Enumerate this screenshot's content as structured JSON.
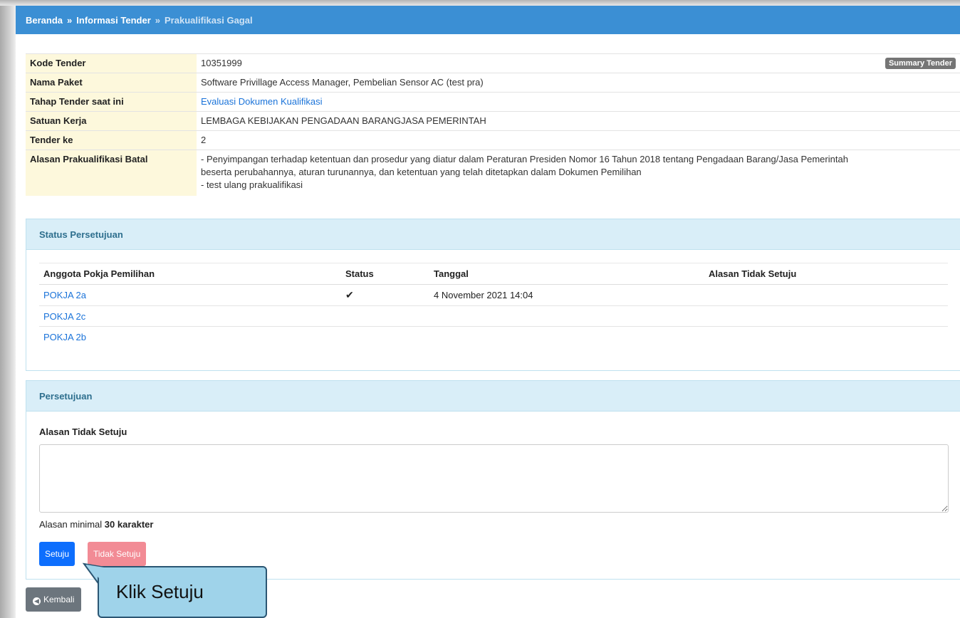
{
  "breadcrumb": {
    "home": "Beranda",
    "separator": "»",
    "info": "Informasi Tender",
    "current": "Prakualifikasi Gagal"
  },
  "info_table": {
    "summary_button": "Summary Tender",
    "rows": [
      {
        "key": "Kode Tender",
        "value": "10351999"
      },
      {
        "key": "Nama Paket",
        "value": "Software Privillage Access Manager, Pembelian Sensor AC (test pra)"
      },
      {
        "key": "Tahap Tender saat ini",
        "value": "Evaluasi Dokumen Kualifikasi"
      },
      {
        "key": "Satuan Kerja",
        "value": "LEMBAGA KEBIJAKAN PENGADAAN BARANGJASA PEMERINTAH"
      },
      {
        "key": "Tender ke",
        "value": "2"
      },
      {
        "key": "Alasan Prakualifikasi Batal",
        "line1": "- Penyimpangan terhadap ketentuan dan prosedur yang diatur dalam Peraturan Presiden Nomor 16 Tahun 2018 tentang Pengadaan Barang/Jasa Pemerintah",
        "line2": "beserta perubahannya, aturan turunannya, dan ketentuan yang telah ditetapkan dalam Dokumen Pemilihan",
        "line3": "- test ulang prakualifikasi"
      }
    ]
  },
  "status_panel": {
    "title": "Status Persetujuan",
    "columns": [
      "Anggota Pokja Pemilihan",
      "Status",
      "Tanggal",
      "Alasan Tidak Setuju"
    ],
    "rows": [
      {
        "member": "POKJA 2a",
        "status_icon": "check-icon",
        "status_glyph": "✔",
        "date": "4 November 2021 14:04",
        "reason": ""
      },
      {
        "member": "POKJA 2c",
        "status_glyph": "",
        "date": "",
        "reason": ""
      },
      {
        "member": "POKJA 2b",
        "status_glyph": "",
        "date": "",
        "reason": ""
      }
    ]
  },
  "approval_panel": {
    "title": "Persetujuan",
    "reason_label": "Alasan Tidak Setuju",
    "reason_value": "",
    "hint_prefix": "Alasan minimal",
    "hint_bold": "30 karakter",
    "approve_label": "Setuju",
    "reject_label": "Tidak Setuju"
  },
  "back_button": {
    "icon": "arrow-left-circle-icon",
    "label": "Kembali"
  },
  "callout": {
    "text": "Klik Setuju"
  },
  "colors": {
    "header": "#3b8fd4",
    "panel_head": "#d9eef8",
    "primary": "#0d6efd",
    "danger": "#f28b95",
    "callout": "#9fd3ea"
  }
}
